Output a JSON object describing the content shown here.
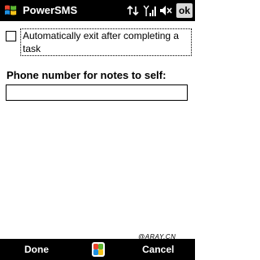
{
  "titlebar": {
    "app_title": "PowerSMS",
    "ok_label": "ok",
    "icons": [
      "windows-start-icon",
      "connectivity-icon",
      "signal-strength-icon",
      "volume-muted-icon"
    ]
  },
  "content": {
    "auto_exit_label": "Automatically exit after completing a task",
    "auto_exit_checked": false,
    "phone_section_label": "Phone number for notes to self:",
    "phone_value": ""
  },
  "watermark": "@ARAY.CN",
  "softkeys": {
    "left_label": "Done",
    "right_label": "Cancel"
  },
  "colors": {
    "bar_background": "#000000",
    "bar_text": "#ffffff",
    "page_background": "#ffffff"
  }
}
